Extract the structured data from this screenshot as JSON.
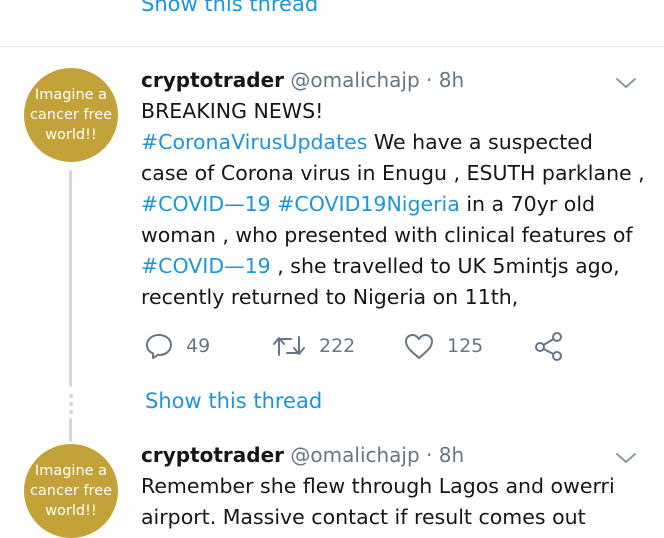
{
  "top": {
    "show_thread": "Show this thread"
  },
  "tweet1": {
    "avatar": {
      "line1": "Imagine a",
      "line2": "cancer free",
      "line3": "world!!"
    },
    "name": "cryptotrader",
    "handle": "@omalichajp",
    "sep": "·",
    "time": "8h",
    "line1": "BREAKING NEWS!",
    "line2_tag": "#CoronaVirusUpdates",
    "line2_rest": " We have a suspected",
    "line3": "case of Corona virus in Enugu , ESUTH parklane ,",
    "line4_tag1": "#COVID—19",
    "line4_sp": " ",
    "line4_tag2": "#COVID19Nigeria",
    "line4_rest": " in a 70yr old",
    "line5": "woman , who presented with clinical features of",
    "line6_tag": "#COVID—19",
    "line6_rest": " , she travelled to UK 5mintjs ago,",
    "line7": "recently returned to Nigeria on 11th,",
    "replies": "49",
    "retweets": "222",
    "likes": "125",
    "show_thread": "Show this thread"
  },
  "tweet2": {
    "avatar": {
      "line1": "Imagine a",
      "line2": "cancer free",
      "line3": "world!!"
    },
    "name": "cryptotrader",
    "handle": "@omalichajp",
    "sep": "·",
    "time": "8h",
    "line1": "Remember she flew through Lagos and owerri",
    "line2": "airport. Massive contact if result comes out"
  },
  "colors": {
    "link": "#1b95e0",
    "avatar_bg": "#c3a23a",
    "muted": "#657786"
  },
  "icons": [
    "reply-icon",
    "retweet-icon",
    "like-icon",
    "share-icon",
    "chevron-down-icon"
  ]
}
